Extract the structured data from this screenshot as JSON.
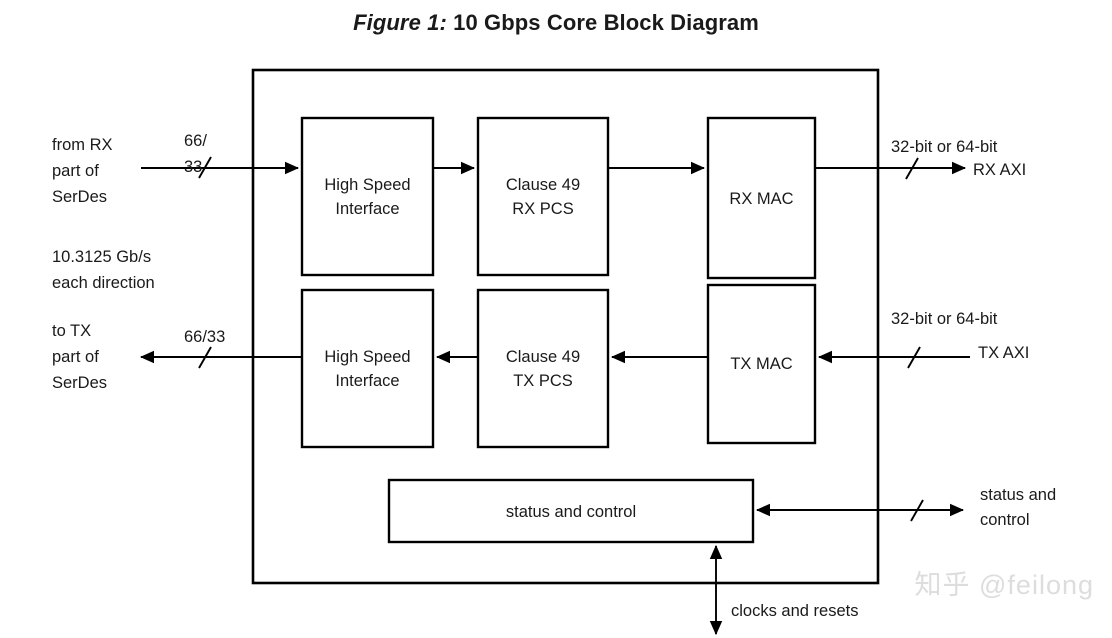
{
  "figure": {
    "label": "Figure 1:",
    "title": "10 Gbps Core Block Diagram"
  },
  "watermark": "知乎 @feilong",
  "blocks": [
    {
      "id": "high-speed-interface-rx",
      "line1": "High Speed",
      "line2": "Interface"
    },
    {
      "id": "clause-49-rx-pcs",
      "line1": "Clause 49",
      "line2": "RX PCS"
    },
    {
      "id": "rx-mac",
      "line1": "RX MAC",
      "line2": ""
    },
    {
      "id": "high-speed-interface-tx",
      "line1": "High Speed",
      "line2": "Interface"
    },
    {
      "id": "clause-49-tx-pcs",
      "line1": "Clause 49",
      "line2": "TX PCS"
    },
    {
      "id": "tx-mac",
      "line1": "TX MAC",
      "line2": ""
    },
    {
      "id": "status-and-control",
      "line1": "status and control",
      "line2": ""
    }
  ],
  "labels": {
    "from_rx_serdes": {
      "l1": "from RX",
      "l2": "part of",
      "l3": "SerDes"
    },
    "to_tx_serdes": {
      "l1": "to TX",
      "l2": "part of",
      "l3": "SerDes"
    },
    "line_rate": {
      "l1": "10.3125 Gb/s",
      "l2": "each direction"
    },
    "rx_bus_width": {
      "l1": "66/",
      "l2": "33"
    },
    "tx_bus_width": {
      "l1": "66/33"
    },
    "rx_axi_width": {
      "l1": "32-bit or 64-bit"
    },
    "rx_axi": {
      "l1": "RX AXI"
    },
    "tx_axi_width": {
      "l1": "32-bit or 64-bit"
    },
    "tx_axi": {
      "l1": "TX AXI"
    },
    "status_control_ext": {
      "l1": "status and",
      "l2": "control"
    },
    "clocks_and_resets": {
      "l1": "clocks and resets"
    }
  },
  "colors": {
    "stroke": "#000000",
    "text": "#1a1a1a",
    "background": "#ffffff",
    "watermark": "#dddddd"
  }
}
